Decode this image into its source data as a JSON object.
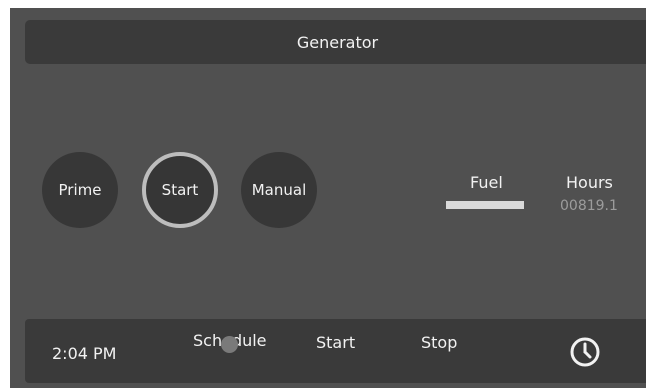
{
  "header": {
    "title": "Generator"
  },
  "controls": {
    "prime_label": "Prime",
    "start_label": "Start",
    "manual_label": "Manual",
    "active_mode": "Start"
  },
  "status": {
    "fuel_label": "Fuel",
    "fuel_level": 1.0,
    "hours_label": "Hours",
    "hours_value": "00819.1"
  },
  "footer": {
    "time": "2:04 PM",
    "schedule_label": "Schedule",
    "start_label": "Start",
    "stop_label": "Stop",
    "clock_icon": "clock-icon",
    "page_indicator": "dot"
  },
  "colors": {
    "background": "#505050",
    "panel": "#3a3a3a",
    "text": "#f2f2f2",
    "active_ring": "#bdbdbd",
    "muted_value": "#9c9c9c"
  }
}
